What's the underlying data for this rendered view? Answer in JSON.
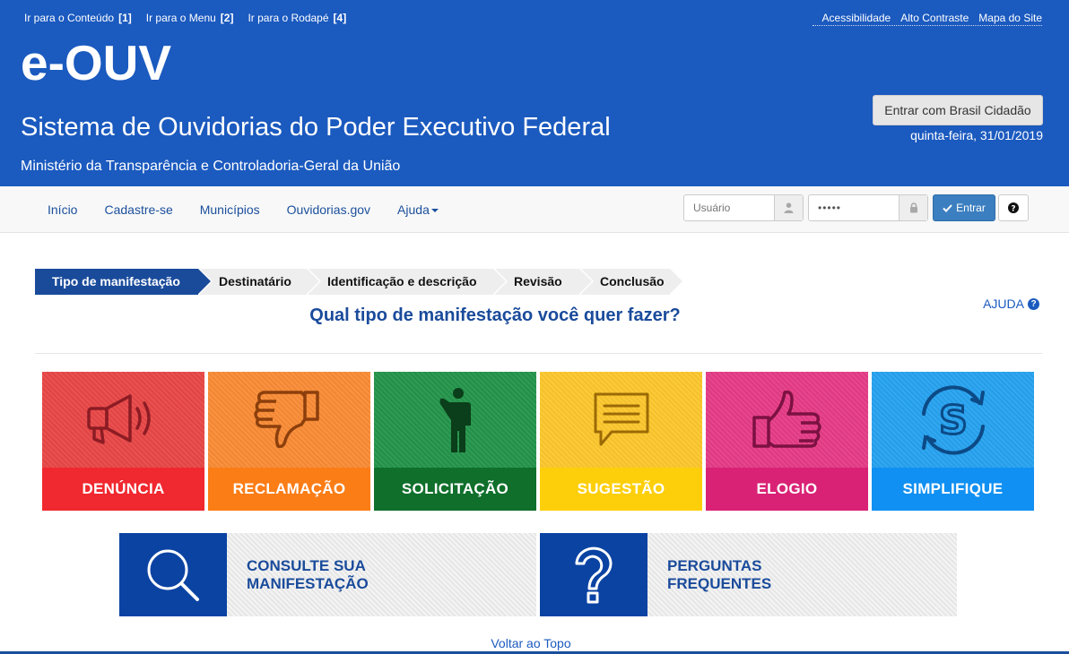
{
  "skip_links": [
    {
      "label": "Ir para o Conteúdo",
      "key": "[1]"
    },
    {
      "label": "Ir para o Menu",
      "key": "[2]"
    },
    {
      "label": "Ir para o Rodapé",
      "key": "[4]"
    }
  ],
  "top_links": [
    "Acessibilidade",
    "Alto Contraste",
    "Mapa do Site"
  ],
  "header": {
    "brand": "e-OUV",
    "title": "Sistema de Ouvidorias do Poder Executivo Federal",
    "ministry": "Ministério da Transparência e Controladoria-Geral da União",
    "login_button": "Entrar com Brasil Cidadão",
    "date": "quinta-feira, 31/01/2019"
  },
  "nav": {
    "items": [
      "Início",
      "Cadastre-se",
      "Municípios",
      "Ouvidorias.gov",
      "Ajuda"
    ],
    "user_placeholder": "Usuário",
    "password_value": "•••••",
    "login_label": "Entrar"
  },
  "steps": [
    "Tipo de manifestação",
    "Destinatário",
    "Identificação e descrição",
    "Revisão",
    "Conclusão"
  ],
  "question": "Qual tipo de manifestação você quer fazer?",
  "help_label": "AJUDA",
  "tiles": [
    {
      "label": "DENÚNCIA",
      "icon": "megaphone-icon",
      "top": "#e84646",
      "bottom": "#f0282f",
      "stroke": "#8c1c24"
    },
    {
      "label": "RECLAMAÇÃO",
      "icon": "thumbs-down-icon",
      "top": "#f98b35",
      "bottom": "#fb7d16",
      "stroke": "#8c3f0c"
    },
    {
      "label": "SOLICITAÇÃO",
      "icon": "person-raising-hand-icon",
      "top": "#23944a",
      "bottom": "#0f6f2b",
      "stroke": "#0b3e1a"
    },
    {
      "label": "SUGESTÃO",
      "icon": "speech-bubble-icon",
      "top": "#fcc72d",
      "bottom": "#fdcf0a",
      "stroke": "#9b6a06"
    },
    {
      "label": "ELOGIO",
      "icon": "thumbs-up-icon",
      "top": "#e53b86",
      "bottom": "#d92275",
      "stroke": "#7c1142"
    },
    {
      "label": "SIMPLIFIQUE",
      "icon": "simplifique-icon",
      "top": "#26a2ef",
      "bottom": "#1090f2",
      "stroke": "#0c4a86"
    }
  ],
  "cards": [
    {
      "line1": "CONSULTE SUA",
      "line2": "MANIFESTAÇÃO",
      "icon": "magnifier-icon"
    },
    {
      "line1": "PERGUNTAS",
      "line2": "FREQUENTES",
      "icon": "question-mark-icon"
    }
  ],
  "back_to_top": "Voltar ao Topo"
}
